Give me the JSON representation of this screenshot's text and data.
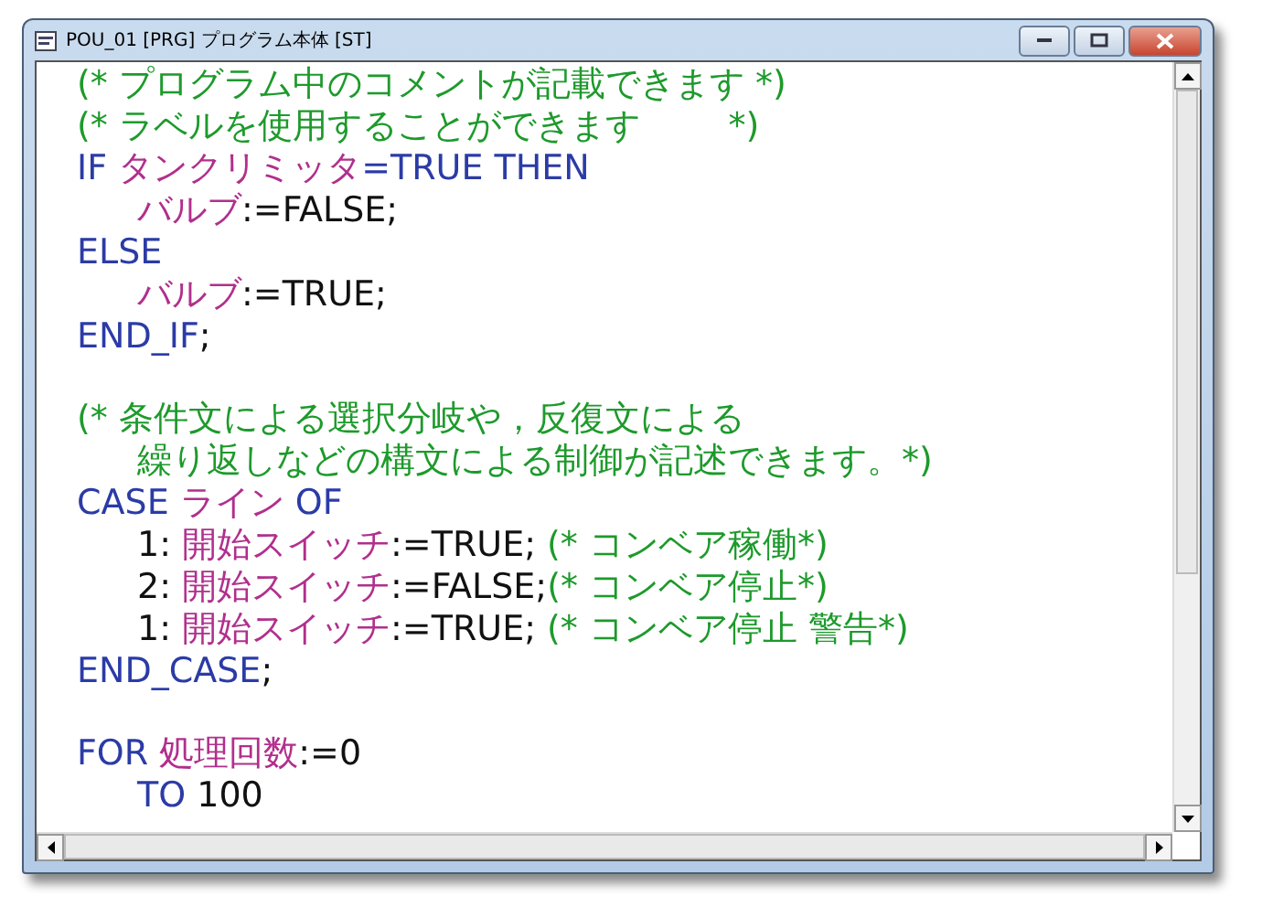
{
  "window": {
    "title": "POU_01 [PRG] プログラム本体 [ST]"
  },
  "editor": {
    "blocks": [
      {
        "lines": [
          {
            "indented": false,
            "segments": [
              {
                "kind": "comment",
                "text": "(* プログラム中のコメントが記載できます *)"
              }
            ]
          },
          {
            "indented": false,
            "segments": [
              {
                "kind": "comment",
                "text": "(* ラベルを使用することができます        *)"
              }
            ]
          },
          {
            "indented": false,
            "segments": [
              {
                "kind": "keyword",
                "text": "IF "
              },
              {
                "kind": "identifier",
                "text": "タンクリミッタ"
              },
              {
                "kind": "keyword",
                "text": "=TRUE THEN"
              }
            ]
          },
          {
            "indented": true,
            "segments": [
              {
                "kind": "identifier",
                "text": "バルブ"
              },
              {
                "kind": "plain",
                "text": ":=FALSE;"
              }
            ]
          },
          {
            "indented": false,
            "segments": [
              {
                "kind": "keyword",
                "text": "ELSE"
              }
            ]
          },
          {
            "indented": true,
            "segments": [
              {
                "kind": "identifier",
                "text": "バルブ"
              },
              {
                "kind": "plain",
                "text": ":=TRUE;"
              }
            ]
          },
          {
            "indented": false,
            "segments": [
              {
                "kind": "keyword",
                "text": "END_IF"
              },
              {
                "kind": "plain",
                "text": ";"
              }
            ]
          }
        ]
      },
      {
        "lines": [
          {
            "indented": false,
            "segments": [
              {
                "kind": "comment",
                "text": "(* 条件文による選択分岐や，反復文による"
              }
            ]
          },
          {
            "indented": true,
            "segments": [
              {
                "kind": "comment",
                "text": "繰り返しなどの構文による制御が記述できます。*)"
              }
            ]
          },
          {
            "indented": false,
            "segments": [
              {
                "kind": "keyword",
                "text": "CASE "
              },
              {
                "kind": "identifier",
                "text": "ライン"
              },
              {
                "kind": "keyword",
                "text": " OF"
              }
            ]
          },
          {
            "indented": true,
            "segments": [
              {
                "kind": "plain",
                "text": "1: "
              },
              {
                "kind": "identifier",
                "text": "開始スイッチ"
              },
              {
                "kind": "plain",
                "text": ":=TRUE; "
              },
              {
                "kind": "comment",
                "text": "(* コンベア稼働*)"
              }
            ]
          },
          {
            "indented": true,
            "segments": [
              {
                "kind": "plain",
                "text": "2: "
              },
              {
                "kind": "identifier",
                "text": "開始スイッチ"
              },
              {
                "kind": "plain",
                "text": ":=FALSE;"
              },
              {
                "kind": "comment",
                "text": "(* コンベア停止*)"
              }
            ]
          },
          {
            "indented": true,
            "segments": [
              {
                "kind": "plain",
                "text": "1: "
              },
              {
                "kind": "identifier",
                "text": "開始スイッチ"
              },
              {
                "kind": "plain",
                "text": ":=TRUE; "
              },
              {
                "kind": "comment",
                "text": "(* コンベア停止 警告*)"
              }
            ]
          },
          {
            "indented": false,
            "segments": [
              {
                "kind": "keyword",
                "text": "END_CASE"
              },
              {
                "kind": "plain",
                "text": ";"
              }
            ]
          }
        ]
      },
      {
        "lines": [
          {
            "indented": false,
            "segments": [
              {
                "kind": "keyword",
                "text": "FOR "
              },
              {
                "kind": "identifier",
                "text": "処理回数"
              },
              {
                "kind": "plain",
                "text": ":=0"
              }
            ]
          },
          {
            "indented": true,
            "segments": [
              {
                "kind": "keyword",
                "text": "TO "
              },
              {
                "kind": "plain",
                "text": "100"
              }
            ]
          }
        ]
      }
    ]
  }
}
